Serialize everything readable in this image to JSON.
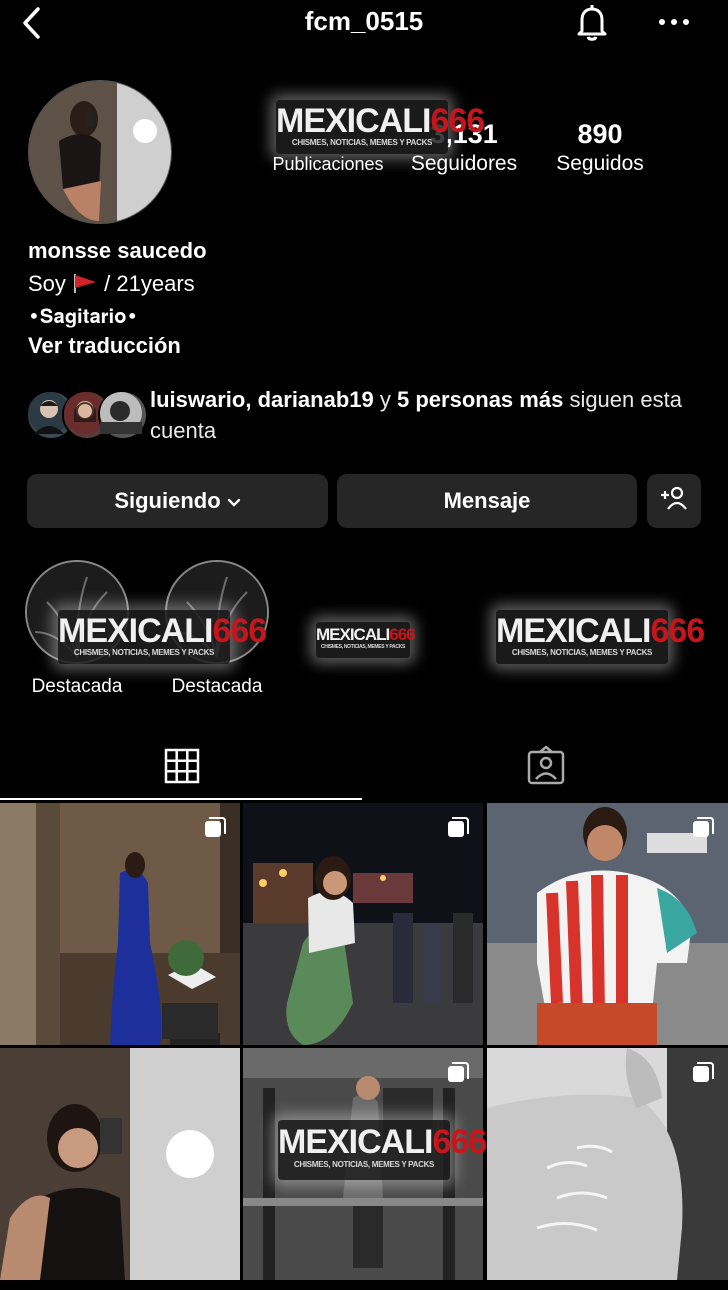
{
  "header": {
    "username": "fcm_0515",
    "back_icon": "chevron-left-icon",
    "bell_icon": "bell-icon",
    "more_icon": "more-horizontal-icon"
  },
  "profile": {
    "display_name": "monsse saucedo",
    "bio_line1_prefix": "Soy",
    "bio_flag": "🚩",
    "bio_line1_suffix": "/ 21years",
    "bio_line2": "•𝐒𝐚𝐠𝐢𝐭𝐚𝐫𝐢𝐨•",
    "translate_link": "Ver traducción"
  },
  "stats": {
    "posts_label": "Publicaciones",
    "followers_value": "3,131",
    "followers_label": "Seguidores",
    "following_value": "890",
    "following_label": "Seguidos"
  },
  "followed_by": {
    "names": "luiswario, darianab19",
    "connector": "y",
    "others": "5 personas más",
    "suffix": "siguen esta cuenta"
  },
  "actions": {
    "following_label": "Siguiendo",
    "message_label": "Mensaje",
    "add_user_icon": "add-user-icon"
  },
  "highlights": [
    {
      "label": "Destacada"
    },
    {
      "label": "Destacada"
    }
  ],
  "watermark": {
    "word": "MEXICALI",
    "number": "666",
    "tagline": "CHISMES, NOTICIAS, MEMES Y PACKS"
  },
  "tabs": {
    "grid_icon": "grid-icon",
    "tagged_icon": "tagged-person-icon"
  },
  "posts": [
    {
      "type": "carousel"
    },
    {
      "type": "carousel"
    },
    {
      "type": "carousel"
    },
    {
      "type": "single"
    },
    {
      "type": "carousel"
    },
    {
      "type": "carousel"
    }
  ]
}
